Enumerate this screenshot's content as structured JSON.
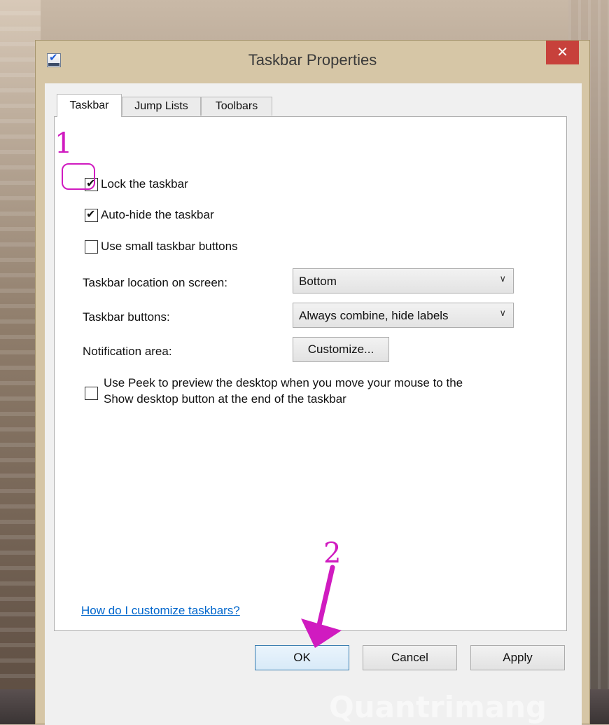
{
  "window": {
    "title": "Taskbar Properties",
    "close_glyph": "✕"
  },
  "tabs": [
    {
      "label": "Taskbar",
      "active": true
    },
    {
      "label": "Jump Lists",
      "active": false
    },
    {
      "label": "Toolbars",
      "active": false
    }
  ],
  "options": {
    "lock": {
      "label": "Lock the taskbar",
      "checked": true
    },
    "autohide": {
      "label": "Auto-hide the taskbar",
      "checked": true
    },
    "small": {
      "label": "Use small taskbar buttons",
      "checked": false
    },
    "peek": {
      "line1": "Use Peek to preview the desktop when you move your mouse to the",
      "line2": "Show desktop button at the end of the taskbar",
      "checked": false
    }
  },
  "location": {
    "label": "Taskbar location on screen:",
    "value": "Bottom"
  },
  "buttons_setting": {
    "label": "Taskbar buttons:",
    "value": "Always combine, hide labels"
  },
  "notification": {
    "label": "Notification area:",
    "button": "Customize..."
  },
  "help_link": "How do I customize taskbars?",
  "footer": {
    "ok": "OK",
    "cancel": "Cancel",
    "apply": "Apply"
  },
  "annotations": {
    "step1": "1",
    "step2": "2",
    "color": "#d01bc0"
  },
  "icons": {
    "check": "✔",
    "chevron": "∨"
  },
  "watermark": "Quantrimang"
}
